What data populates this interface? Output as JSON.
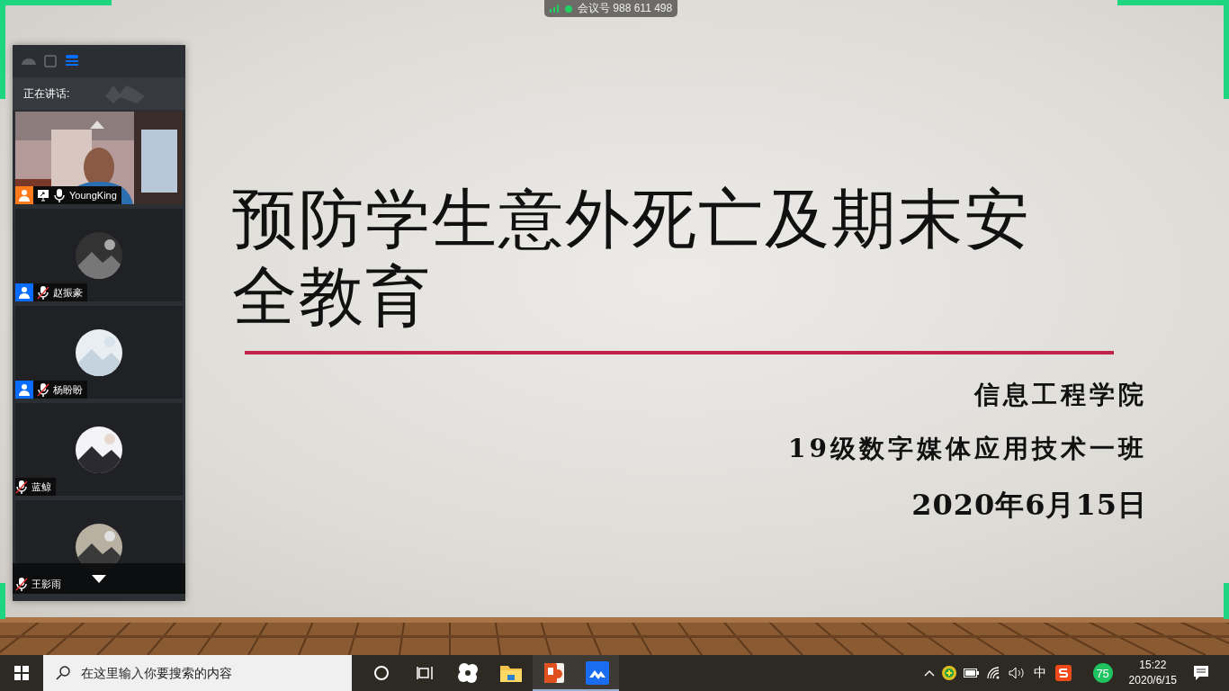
{
  "meeting_bar": {
    "meeting_id": "会议号 988 611 498"
  },
  "panel": {
    "views": [
      {
        "kind": "minimize",
        "selected": false
      },
      {
        "kind": "window",
        "selected": false
      },
      {
        "kind": "list",
        "selected": true
      }
    ],
    "speaking_label": "正在讲话:",
    "participants": [
      {
        "name": "YoungKing",
        "kind": "video",
        "color": "#ff7a1a",
        "sharing": true,
        "muted": false
      },
      {
        "name": "赵振豪",
        "kind": "avatar",
        "color": "#0a6cff",
        "sharing": false,
        "muted": true
      },
      {
        "name": "杨盼盼",
        "kind": "avatar",
        "color": "#0a6cff",
        "sharing": false,
        "muted": true
      },
      {
        "name": "蓝鲸",
        "kind": "avatar",
        "sharing": false,
        "muted": true
      },
      {
        "name": "王影雨",
        "kind": "avatar",
        "sharing": false,
        "muted": true
      }
    ]
  },
  "slide": {
    "title": "预防学生意外死亡及期末安全教育",
    "lines": [
      "信息工程学院",
      "19级数字媒体应用技术一班",
      "2020年6月15日"
    ]
  },
  "taskbar": {
    "search": {
      "placeholder": "在这里输入你要搜索的内容"
    },
    "apps": [
      {
        "kind": "cortana",
        "running": false
      },
      {
        "kind": "taskview",
        "running": false
      },
      {
        "kind": "pinwheel",
        "running": false
      },
      {
        "kind": "folder",
        "running": false
      },
      {
        "kind": "powerpoint",
        "running": true
      },
      {
        "kind": "meeting",
        "running": true
      }
    ],
    "tray": {
      "ime": "中",
      "badge": "75",
      "time": "15:22",
      "date": "2020/6/15"
    }
  }
}
